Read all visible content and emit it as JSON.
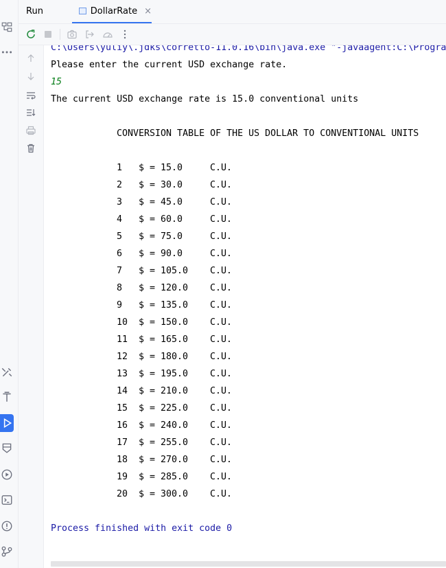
{
  "panel": {
    "title": "Run"
  },
  "tab": {
    "label": "DollarRate",
    "close": "×"
  },
  "colors": {
    "accent": "#3574f0",
    "command_text": "#1a1aa6",
    "user_input": "#067d17"
  },
  "console": {
    "command_line": "C:\\Users\\yuliy\\.jdks\\corretto-11.0.16\\bin\\java.exe \"-javaagent:C:\\Progra",
    "prompt": "Please enter the current USD exchange rate.",
    "user_input": "15",
    "result": "The current USD exchange rate is 15.0 conventional units",
    "table_title": "CONVERSION TABLE OF THE US DOLLAR TO CONVENTIONAL UNITS",
    "rows": [
      {
        "n": "1",
        "d": "$ =",
        "v": "15.0",
        "u": "C.U."
      },
      {
        "n": "2",
        "d": "$ =",
        "v": "30.0",
        "u": "C.U."
      },
      {
        "n": "3",
        "d": "$ =",
        "v": "45.0",
        "u": "C.U."
      },
      {
        "n": "4",
        "d": "$ =",
        "v": "60.0",
        "u": "C.U."
      },
      {
        "n": "5",
        "d": "$ =",
        "v": "75.0",
        "u": "C.U."
      },
      {
        "n": "6",
        "d": "$ =",
        "v": "90.0",
        "u": "C.U."
      },
      {
        "n": "7",
        "d": "$ =",
        "v": "105.0",
        "u": "C.U."
      },
      {
        "n": "8",
        "d": "$ =",
        "v": "120.0",
        "u": "C.U."
      },
      {
        "n": "9",
        "d": "$ =",
        "v": "135.0",
        "u": "C.U."
      },
      {
        "n": "10",
        "d": "$ =",
        "v": "150.0",
        "u": "C.U."
      },
      {
        "n": "11",
        "d": "$ =",
        "v": "165.0",
        "u": "C.U."
      },
      {
        "n": "12",
        "d": "$ =",
        "v": "180.0",
        "u": "C.U."
      },
      {
        "n": "13",
        "d": "$ =",
        "v": "195.0",
        "u": "C.U."
      },
      {
        "n": "14",
        "d": "$ =",
        "v": "210.0",
        "u": "C.U."
      },
      {
        "n": "15",
        "d": "$ =",
        "v": "225.0",
        "u": "C.U."
      },
      {
        "n": "16",
        "d": "$ =",
        "v": "240.0",
        "u": "C.U."
      },
      {
        "n": "17",
        "d": "$ =",
        "v": "255.0",
        "u": "C.U."
      },
      {
        "n": "18",
        "d": "$ =",
        "v": "270.0",
        "u": "C.U."
      },
      {
        "n": "19",
        "d": "$ =",
        "v": "285.0",
        "u": "C.U."
      },
      {
        "n": "20",
        "d": "$ =",
        "v": "300.0",
        "u": "C.U."
      }
    ],
    "exit_message": "Process finished with exit code 0"
  },
  "icons": {
    "left_strip": [
      "structure-icon",
      "more-icon",
      "build-icon",
      "hammer-icon",
      "run-icon",
      "debug-icon",
      "services-icon",
      "terminal-icon",
      "problems-icon",
      "git-icon"
    ],
    "toolbar": [
      "rerun-icon",
      "stop-icon",
      "screenshot-icon",
      "restore-layout-icon",
      "coverage-icon",
      "more-options-icon"
    ],
    "console_side": [
      "scroll-up-icon",
      "scroll-down-icon",
      "soft-wrap-icon",
      "scroll-to-end-icon",
      "print-icon",
      "clear-all-icon"
    ]
  }
}
